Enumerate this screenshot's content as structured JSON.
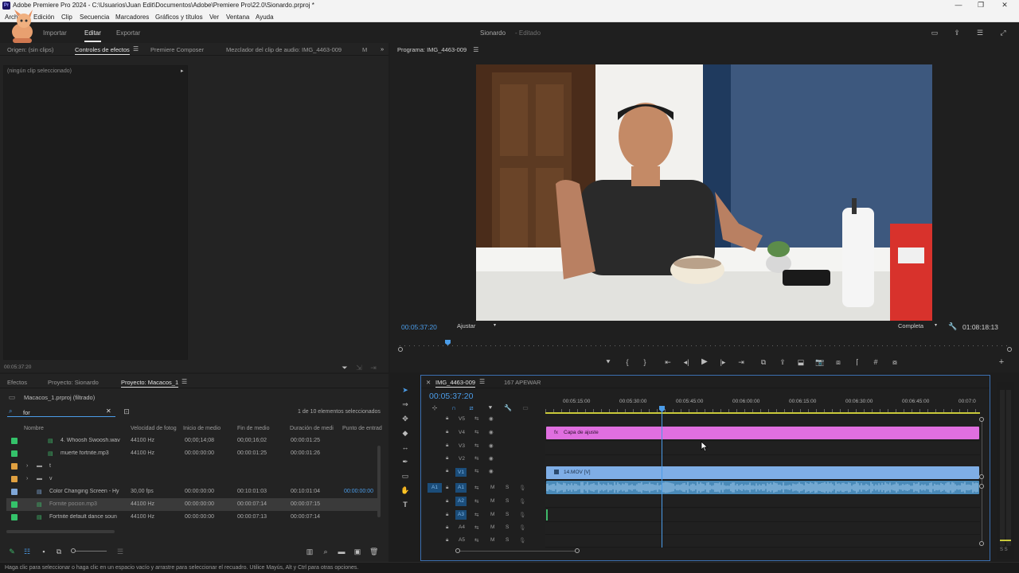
{
  "app": {
    "title": "Adobe Premiere Pro 2024 - C:\\Usuarios\\Juan Edit\\Documentos\\Adobe\\Premiere Pro\\22.0\\Sionardo.prproj *",
    "logo": "Pr"
  },
  "menu": [
    "Archivo",
    "Edición",
    "Clip",
    "Secuencia",
    "Marcadores",
    "Gráficos y títulos",
    "Ver",
    "Ventana",
    "Ayuda"
  ],
  "workspace": {
    "tabs": [
      "Importar",
      "Editar",
      "Exportar"
    ],
    "active": "Editar",
    "project_name": "Sionardo",
    "project_state": "- Editado"
  },
  "source_panel": {
    "tabs": [
      "Origen: (sin clips)",
      "Controles de efectos",
      "Premiere Composer",
      "Mezclador del clip de audio: IMG_4463-009",
      "M"
    ],
    "empty_msg": "(ningún clip seleccionado)",
    "timecode": "00:05:37:20"
  },
  "program_panel": {
    "title": "Programa: IMG_4463-009",
    "timecode": "00:05:37:20",
    "fit": "Ajustar",
    "quality": "Completa",
    "duration": "01:08:18:13"
  },
  "project_panel": {
    "tabs": [
      "Efectos",
      "Proyecto: Sionardo",
      "Proyecto: Macacos_1"
    ],
    "active": "Proyecto: Macacos_1",
    "bin_title": "Macacos_1.prproj (filtrado)",
    "search_value": "for",
    "selection_info": "1 de 10 elementos seleccionados",
    "columns": [
      "Nombre",
      "Velocidad de fotog",
      "Inicio de medio",
      "Fin de medio",
      "Duración de medi",
      "Punto de entrad"
    ],
    "rows": [
      {
        "color": "#34c26a",
        "name": "4. Whoosh Swoosh.wav",
        "rate": "44100 Hz",
        "start": "00;00;14;08",
        "end": "00;00;16;02",
        "dur": "00:00:01:25",
        "in": ""
      },
      {
        "color": "#34c26a",
        "name": "muerte fortnite.mp3",
        "rate": "44100 Hz",
        "start": "00:00:00:00",
        "end": "00:00:01:25",
        "dur": "00:00:01:26",
        "in": ""
      },
      {
        "color": "#e0a040",
        "name": "t",
        "rate": "",
        "start": "",
        "end": "",
        "dur": "",
        "in": ""
      },
      {
        "color": "#e0a040",
        "name": "v",
        "rate": "",
        "start": "",
        "end": "",
        "dur": "",
        "in": ""
      },
      {
        "color": "#7fa7d8",
        "name": "Color Changing Screen - Hy",
        "rate": "30,00 fps",
        "start": "00:00:00:00",
        "end": "00:10:01:03",
        "dur": "00:10:01:04",
        "in": "00:00:00:00"
      },
      {
        "color": "#34c26a",
        "name": "Fornite pocion.mp3",
        "rate": "44100 Hz",
        "start": "00:00:00:00",
        "end": "00:00:07:14",
        "dur": "00:00:07:15",
        "in": ""
      },
      {
        "color": "#34c26a",
        "name": "Fortnite default dance soun",
        "rate": "44100 Hz",
        "start": "00:00:00:00",
        "end": "00:00:07:13",
        "dur": "00:00:07:14",
        "in": ""
      }
    ]
  },
  "timeline": {
    "tabs": [
      "IMG_4463-009",
      "167 APEWAR"
    ],
    "timecode": "00:05:37:20",
    "ruler": [
      "00:05:15:00",
      "00:05:30:00",
      "00:05:45:00",
      "00:06:00:00",
      "00:06:15:00",
      "00:06:30:00",
      "00:06:45:00",
      "00:07:0"
    ],
    "video_tracks": [
      "V5",
      "V4",
      "V3",
      "V2",
      "V1"
    ],
    "audio_tracks": [
      "A1",
      "A2",
      "A3",
      "A4",
      "A5"
    ],
    "adjustment_clip": "Capa de ajuste",
    "video_clip": "14.MOV [V]",
    "adjustment_color": "#e06fe0",
    "video_color": "#7faee6",
    "audio_color": "#4a8ab8",
    "db_label": "S S"
  },
  "status_bar": "Haga clic para seleccionar o haga clic en un espacio vacío y arrastre para seleccionar el recuadro. Utilice Mayús, Alt y Ctrl para otras opciones."
}
